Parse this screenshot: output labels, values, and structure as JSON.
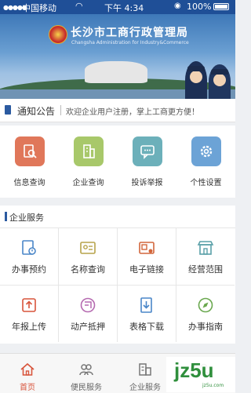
{
  "status_bar": {
    "carrier": "中国移动",
    "time": "下午 4:34",
    "battery": "100%"
  },
  "banner": {
    "title": "长沙市工商行政管理局",
    "subtitle": "Changsha Administration for Industry&Commerce"
  },
  "notice": {
    "label": "通知公告",
    "text": "欢迎企业用户注册，掌上工商更方便！"
  },
  "quick_actions": [
    {
      "label": "信息查询",
      "icon": "search-document-icon",
      "color": "#e0775a"
    },
    {
      "label": "企业查询",
      "icon": "building-icon",
      "color": "#a8c86a"
    },
    {
      "label": "投诉举报",
      "icon": "chat-bubble-icon",
      "color": "#6cb0ba"
    },
    {
      "label": "个性设置",
      "icon": "gear-icon",
      "color": "#6ca3d6"
    }
  ],
  "enterprise_services": {
    "title": "企业服务",
    "items": [
      {
        "label": "办事预约",
        "icon": "appointment-icon",
        "color": "#4a86c8"
      },
      {
        "label": "名称查询",
        "icon": "id-card-icon",
        "color": "#b7a34a"
      },
      {
        "label": "电子链接",
        "icon": "license-icon",
        "color": "#d2663b"
      },
      {
        "label": "经营范围",
        "icon": "shop-icon",
        "color": "#5aa0a8"
      },
      {
        "label": "年报上传",
        "icon": "upload-icon",
        "color": "#d8553c"
      },
      {
        "label": "动产抵押",
        "icon": "pledge-icon",
        "color": "#b56ab0"
      },
      {
        "label": "表格下载",
        "icon": "download-form-icon",
        "color": "#4a86c8"
      },
      {
        "label": "办事指南",
        "icon": "compass-icon",
        "color": "#6aa84f"
      }
    ]
  },
  "bottom_nav": [
    {
      "label": "首页",
      "icon": "home-icon",
      "active": true
    },
    {
      "label": "便民服务",
      "icon": "people-icon",
      "active": false
    },
    {
      "label": "企业服务",
      "icon": "office-icon",
      "active": false
    },
    {
      "label": "",
      "icon": "user-icon",
      "active": false
    }
  ],
  "watermark": {
    "text": "jz5u",
    "domain": "jz5u.com"
  }
}
